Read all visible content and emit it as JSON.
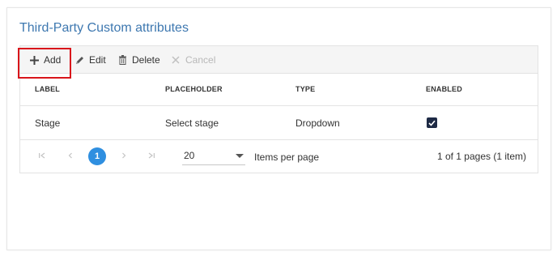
{
  "title": "Third-Party Custom attributes",
  "toolbar": {
    "add_label": "Add",
    "edit_label": "Edit",
    "delete_label": "Delete",
    "cancel_label": "Cancel"
  },
  "columns": [
    "LABEL",
    "PLACEHOLDER",
    "TYPE",
    "ENABLED"
  ],
  "rows": [
    {
      "label": "Stage",
      "placeholder": "Select stage",
      "type": "Dropdown",
      "enabled": true
    }
  ],
  "pager": {
    "current_page": "1",
    "items_per_page": "20",
    "items_per_page_label": "Items per page",
    "info": "1 of 1 pages (1 item)"
  },
  "colors": {
    "title": "#3e78b0",
    "accent": "#2f8fe0",
    "highlight": "#d9151b"
  },
  "icons": [
    "plus-icon",
    "pencil-icon",
    "trash-icon",
    "x-icon",
    "first-page-icon",
    "prev-page-icon",
    "next-page-icon",
    "last-page-icon",
    "caret-down-icon",
    "check-icon"
  ]
}
